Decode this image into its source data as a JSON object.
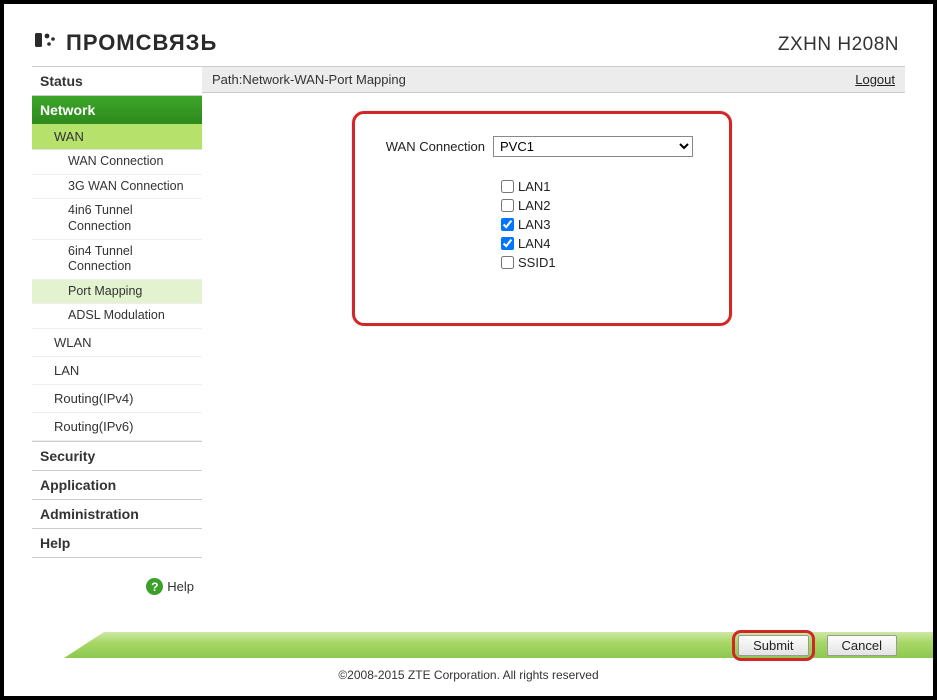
{
  "brand_text": "ПРОМСВЯЗЬ",
  "model": "ZXHN H208N",
  "path_label": "Path:Network-WAN-Port Mapping",
  "logout": "Logout",
  "sidebar": {
    "status": "Status",
    "network": "Network",
    "wan": "WAN",
    "wan_connection": "WAN Connection",
    "wan_3g": "3G WAN Connection",
    "tun4in6": "4in6 Tunnel Connection",
    "tun6in4": "6in4 Tunnel Connection",
    "port_mapping": "Port Mapping",
    "adsl": "ADSL Modulation",
    "wlan": "WLAN",
    "lan": "LAN",
    "routing4": "Routing(IPv4)",
    "routing6": "Routing(IPv6)",
    "security": "Security",
    "application": "Application",
    "administration": "Administration",
    "help": "Help",
    "help_link": "Help"
  },
  "form": {
    "wan_connection_label": "WAN Connection",
    "wan_connection_value": "PVC1",
    "checks": {
      "lan1": {
        "label": "LAN1",
        "checked": false
      },
      "lan2": {
        "label": "LAN2",
        "checked": false
      },
      "lan3": {
        "label": "LAN3",
        "checked": true
      },
      "lan4": {
        "label": "LAN4",
        "checked": true
      },
      "ssid1": {
        "label": "SSID1",
        "checked": false
      }
    }
  },
  "buttons": {
    "submit": "Submit",
    "cancel": "Cancel"
  },
  "copyright": "©2008-2015 ZTE Corporation. All rights reserved"
}
